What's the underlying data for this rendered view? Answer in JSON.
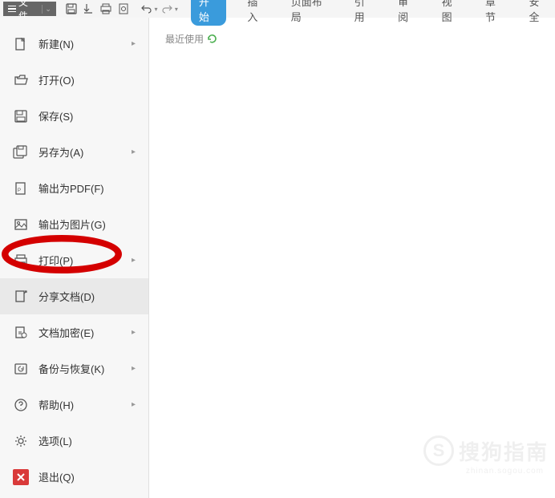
{
  "toolbar": {
    "file_label": "文件"
  },
  "ribbon": {
    "tabs": [
      {
        "label": "开始",
        "active": true
      },
      {
        "label": "插入"
      },
      {
        "label": "页面布局"
      },
      {
        "label": "引用"
      },
      {
        "label": "审阅"
      },
      {
        "label": "视图"
      },
      {
        "label": "章节"
      },
      {
        "label": "安全"
      }
    ]
  },
  "sidebar": {
    "items": [
      {
        "label": "新建(N)",
        "icon": "new",
        "arrow": true
      },
      {
        "label": "打开(O)",
        "icon": "open"
      },
      {
        "label": "保存(S)",
        "icon": "save"
      },
      {
        "label": "另存为(A)",
        "icon": "saveas",
        "arrow": true
      },
      {
        "label": "输出为PDF(F)",
        "icon": "pdf"
      },
      {
        "label": "输出为图片(G)",
        "icon": "image"
      },
      {
        "label": "打印(P)",
        "icon": "print",
        "arrow": true,
        "circled": true
      },
      {
        "label": "分享文档(D)",
        "icon": "share",
        "selected": true
      },
      {
        "label": "文档加密(E)",
        "icon": "encrypt",
        "arrow": true
      },
      {
        "label": "备份与恢复(K)",
        "icon": "backup",
        "arrow": true
      },
      {
        "label": "帮助(H)",
        "icon": "help",
        "arrow": true
      },
      {
        "label": "选项(L)",
        "icon": "options"
      },
      {
        "label": "退出(Q)",
        "icon": "exit"
      }
    ]
  },
  "content": {
    "recent_label": "最近使用"
  },
  "watermark": {
    "logo_letter": "S",
    "text": "搜狗指南",
    "sub": "zhinan.sogou.com"
  }
}
